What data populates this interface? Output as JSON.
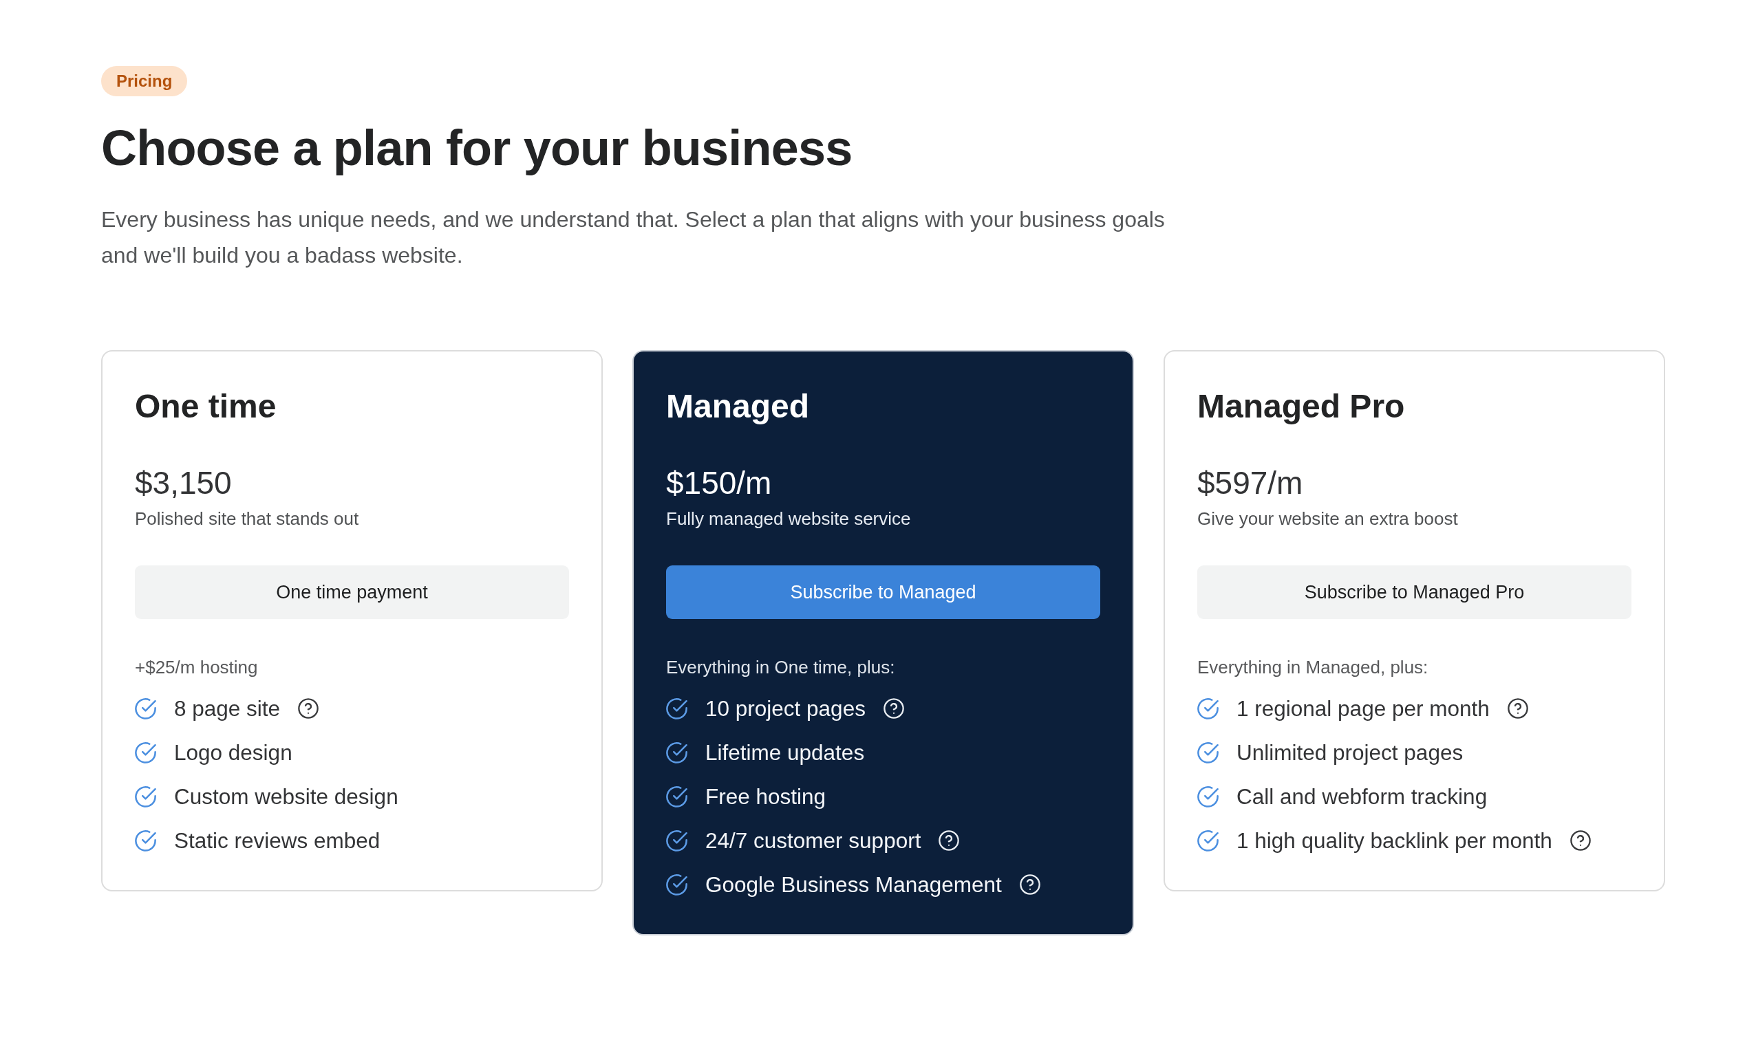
{
  "badge": "Pricing",
  "title": "Choose a plan for your business",
  "subtitle": "Every business has unique needs, and we understand that. Select a plan that aligns with your business goals and we'll build you a badass website.",
  "plans": [
    {
      "name": "One time",
      "highlighted": false,
      "price": "$3,150",
      "tagline": "Polished site that stands out",
      "button": "One time payment",
      "features_heading": "+$25/m hosting",
      "features": [
        {
          "label": "8 page site",
          "help": true
        },
        {
          "label": "Logo design",
          "help": false
        },
        {
          "label": "Custom website design",
          "help": false
        },
        {
          "label": "Static reviews embed",
          "help": false
        }
      ]
    },
    {
      "name": "Managed",
      "highlighted": true,
      "price": "$150/m",
      "tagline": "Fully managed website service",
      "button": "Subscribe to Managed",
      "features_heading": "Everything in One time, plus:",
      "features": [
        {
          "label": "10 project pages",
          "help": true
        },
        {
          "label": "Lifetime updates",
          "help": false
        },
        {
          "label": "Free hosting",
          "help": false
        },
        {
          "label": "24/7 customer support",
          "help": true
        },
        {
          "label": "Google Business Management",
          "help": true
        }
      ]
    },
    {
      "name": "Managed Pro",
      "highlighted": false,
      "price": "$597/m",
      "tagline": "Give your website an extra boost",
      "button": "Subscribe to Managed Pro",
      "features_heading": "Everything in Managed, plus:",
      "features": [
        {
          "label": "1 regional page per month",
          "help": true
        },
        {
          "label": "Unlimited project pages",
          "help": false
        },
        {
          "label": "Call and webform tracking",
          "help": false
        },
        {
          "label": "1 high quality backlink per month",
          "help": true
        }
      ]
    }
  ]
}
